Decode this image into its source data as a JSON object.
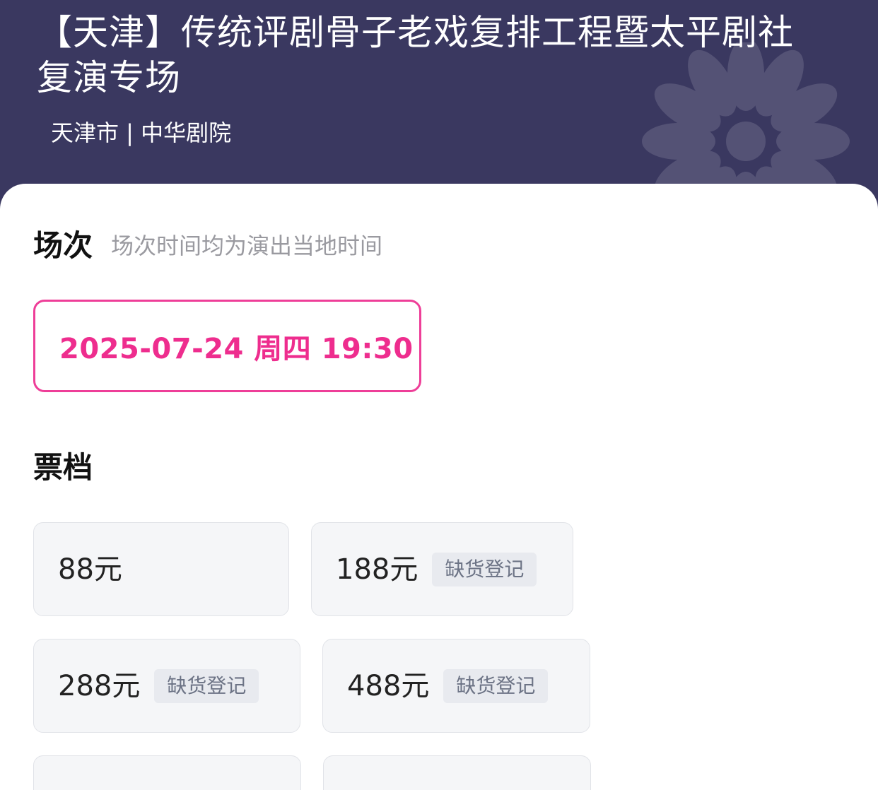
{
  "header": {
    "title": "【天津】传统评剧骨子老戏复排工程暨太平剧社复演专场",
    "location": "天津市 | 中华剧院"
  },
  "sessions": {
    "heading": "场次",
    "note": "场次时间均为演出当地时间",
    "items": [
      {
        "label": "2025-07-24  周四 19:30",
        "selected": true
      }
    ]
  },
  "tickets": {
    "heading": "票档",
    "items": [
      {
        "price": "88元",
        "badge": ""
      },
      {
        "price": "188元",
        "badge": "缺货登记"
      },
      {
        "price": "288元",
        "badge": "缺货登记"
      },
      {
        "price": "488元",
        "badge": "缺货登记"
      }
    ]
  }
}
